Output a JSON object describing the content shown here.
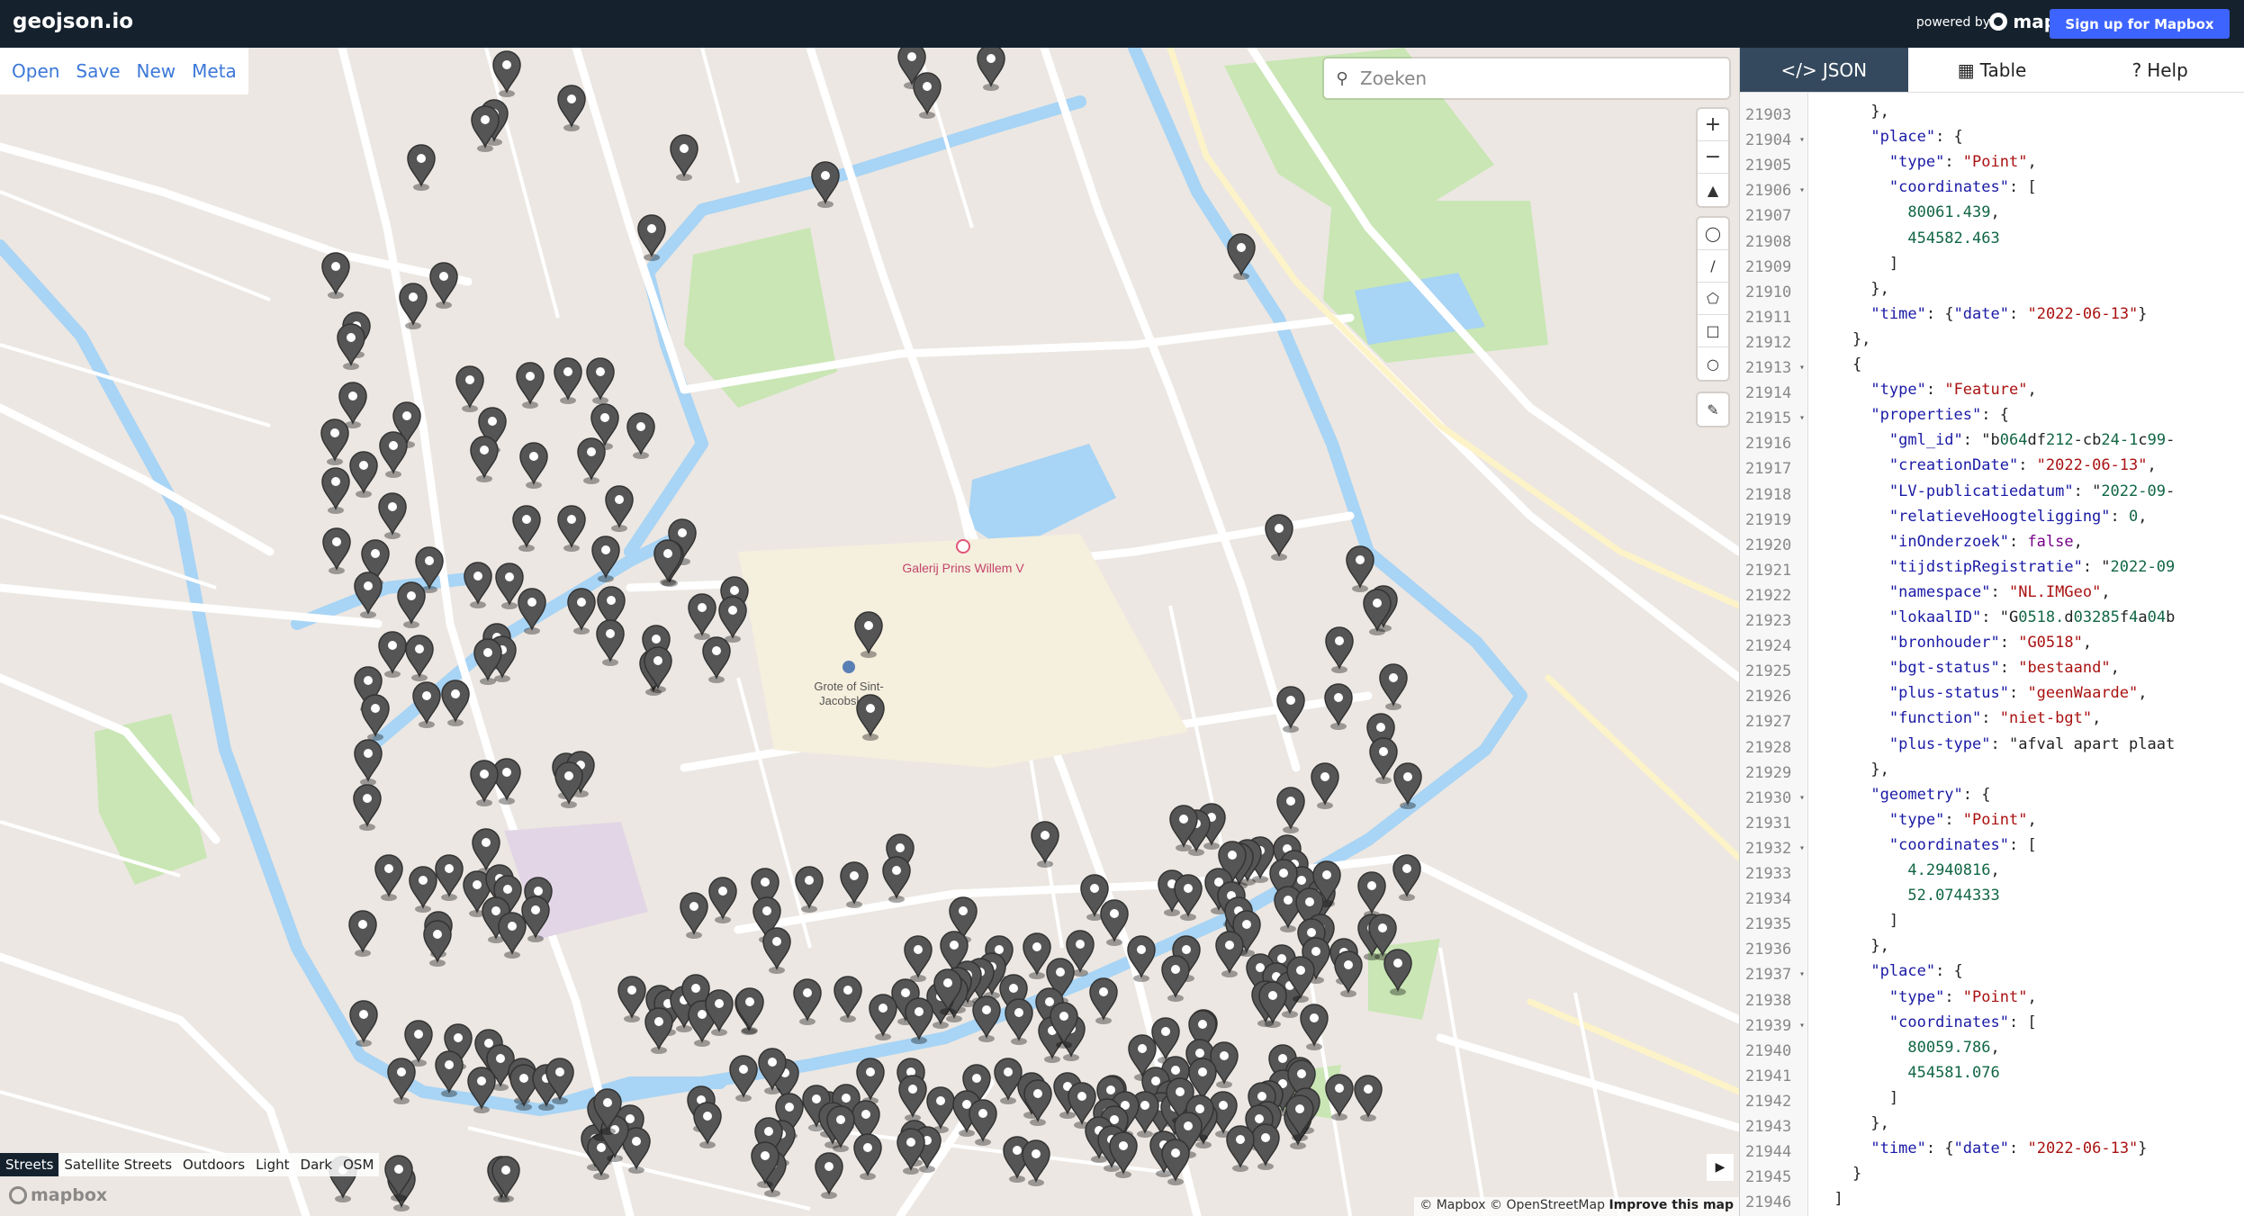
{
  "app": {
    "title": "geojson.io",
    "powered_by": "powered by",
    "partner": "mapbox",
    "signup": "Sign up for Mapbox"
  },
  "file_menu": [
    "Open",
    "Save",
    "New",
    "Meta"
  ],
  "search": {
    "placeholder": "Zoeken"
  },
  "map_controls": {
    "zoom": [
      "zoom-in-icon",
      "zoom-out-icon",
      "compass-icon"
    ],
    "draw": [
      "marker-icon",
      "line-icon",
      "polygon-icon",
      "rectangle-icon",
      "circle-icon"
    ],
    "edit": [
      "edit-icon"
    ]
  },
  "map_labels": {
    "poi1": "Galerij Prins Willem V",
    "poi2_line1": "Grote of Sint-",
    "poi2_line2": "Jacobskerk"
  },
  "map_styles": {
    "items": [
      "Streets",
      "Satellite Streets",
      "Outdoors",
      "Light",
      "Dark",
      "OSM"
    ],
    "selected": "Streets"
  },
  "attribution": {
    "mapbox": "© Mapbox",
    "osm": "© OpenStreetMap",
    "improve": "Improve this map"
  },
  "watermark": "mapbox",
  "panel": {
    "tabs": [
      "JSON",
      "Table",
      "Help"
    ],
    "active": "JSON"
  },
  "colors": {
    "topbar": "#15222e",
    "accent": "#3e64ff",
    "tab_active": "#34495e",
    "water": "#a8d4f5",
    "park": "#c9e6b4"
  },
  "code_lines": [
    {
      "n": "21903",
      "fold": false,
      "t": "      },"
    },
    {
      "n": "21904",
      "fold": true,
      "t": "      \"place\": {"
    },
    {
      "n": "21905",
      "fold": false,
      "t": "        \"type\": \"Point\","
    },
    {
      "n": "21906",
      "fold": true,
      "t": "        \"coordinates\": ["
    },
    {
      "n": "21907",
      "fold": false,
      "t": "          80061.439,"
    },
    {
      "n": "21908",
      "fold": false,
      "t": "          454582.463"
    },
    {
      "n": "21909",
      "fold": false,
      "t": "        ]"
    },
    {
      "n": "21910",
      "fold": false,
      "t": "      },"
    },
    {
      "n": "21911",
      "fold": false,
      "t": "      \"time\": {\"date\": \"2022-06-13\"}"
    },
    {
      "n": "21912",
      "fold": false,
      "t": "    },"
    },
    {
      "n": "21913",
      "fold": true,
      "t": "    {"
    },
    {
      "n": "21914",
      "fold": false,
      "t": "      \"type\": \"Feature\","
    },
    {
      "n": "21915",
      "fold": true,
      "t": "      \"properties\": {"
    },
    {
      "n": "21916",
      "fold": false,
      "t": "        \"gml_id\": \"b064df212-cb24-1c99-"
    },
    {
      "n": "21917",
      "fold": false,
      "t": "        \"creationDate\": \"2022-06-13\","
    },
    {
      "n": "21918",
      "fold": false,
      "t": "        \"LV-publicatiedatum\": \"2022-09-"
    },
    {
      "n": "21919",
      "fold": false,
      "t": "        \"relatieveHoogteligging\": 0,"
    },
    {
      "n": "21920",
      "fold": false,
      "t": "        \"inOnderzoek\": false,"
    },
    {
      "n": "21921",
      "fold": false,
      "t": "        \"tijdstipRegistratie\": \"2022-09"
    },
    {
      "n": "21922",
      "fold": false,
      "t": "        \"namespace\": \"NL.IMGeo\","
    },
    {
      "n": "21923",
      "fold": false,
      "t": "        \"lokaalID\": \"G0518.d03285f4a04b"
    },
    {
      "n": "21924",
      "fold": false,
      "t": "        \"bronhouder\": \"G0518\","
    },
    {
      "n": "21925",
      "fold": false,
      "t": "        \"bgt-status\": \"bestaand\","
    },
    {
      "n": "21926",
      "fold": false,
      "t": "        \"plus-status\": \"geenWaarde\","
    },
    {
      "n": "21927",
      "fold": false,
      "t": "        \"function\": \"niet-bgt\","
    },
    {
      "n": "21928",
      "fold": false,
      "t": "        \"plus-type\": \"afval apart plaat"
    },
    {
      "n": "21929",
      "fold": false,
      "t": "      },"
    },
    {
      "n": "21930",
      "fold": true,
      "t": "      \"geometry\": {"
    },
    {
      "n": "21931",
      "fold": false,
      "t": "        \"type\": \"Point\","
    },
    {
      "n": "21932",
      "fold": true,
      "t": "        \"coordinates\": ["
    },
    {
      "n": "21933",
      "fold": false,
      "t": "          4.2940816,"
    },
    {
      "n": "21934",
      "fold": false,
      "t": "          52.0744333"
    },
    {
      "n": "21935",
      "fold": false,
      "t": "        ]"
    },
    {
      "n": "21936",
      "fold": false,
      "t": "      },"
    },
    {
      "n": "21937",
      "fold": true,
      "t": "      \"place\": {"
    },
    {
      "n": "21938",
      "fold": false,
      "t": "        \"type\": \"Point\","
    },
    {
      "n": "21939",
      "fold": true,
      "t": "        \"coordinates\": ["
    },
    {
      "n": "21940",
      "fold": false,
      "t": "          80059.786,"
    },
    {
      "n": "21941",
      "fold": false,
      "t": "          454581.076"
    },
    {
      "n": "21942",
      "fold": false,
      "t": "        ]"
    },
    {
      "n": "21943",
      "fold": false,
      "t": "      },"
    },
    {
      "n": "21944",
      "fold": false,
      "t": "      \"time\": {\"date\": \"2022-06-13\"}"
    },
    {
      "n": "21945",
      "fold": false,
      "t": "    }"
    },
    {
      "n": "21946",
      "fold": false,
      "t": "  ]"
    }
  ]
}
